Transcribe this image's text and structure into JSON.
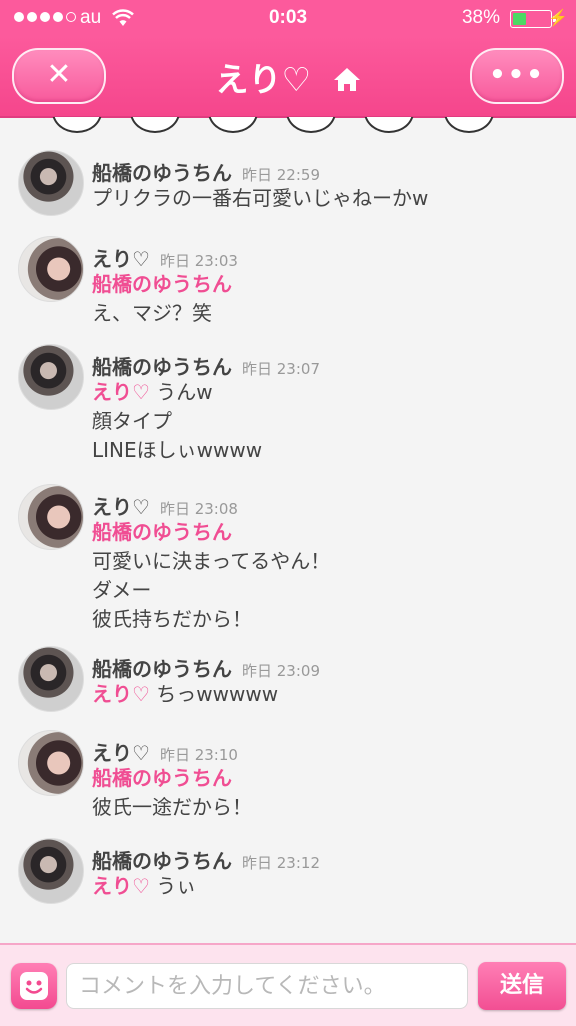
{
  "status_bar": {
    "carrier": "au",
    "time": "0:03",
    "battery_percent": "38%",
    "battery_level": 0.38,
    "signal_bars_filled": 4,
    "signal_bars_total": 5
  },
  "header": {
    "title": "えり♡",
    "close_icon_glyph": "✕",
    "more_icon_glyph": "•••",
    "accent_color": "#fc5a9c"
  },
  "messages": [
    {
      "author": "船橋のゆうちん",
      "avatar": "boy",
      "time": "昨日 22:59",
      "mention": "",
      "text": "プリクラの一番右可愛いじゃねーかw"
    },
    {
      "author": "えり♡",
      "avatar": "girl",
      "time": "昨日 23:03",
      "mention": "船橋のゆうちん",
      "text": "え、マジ？笑"
    },
    {
      "author": "船橋のゆうちん",
      "avatar": "boy",
      "time": "昨日 23:07",
      "mention": "えり♡",
      "text": " うんw\n顔タイプ\nLINEほしぃwwww"
    },
    {
      "author": "えり♡",
      "avatar": "girl",
      "time": "昨日 23:08",
      "mention": "船橋のゆうちん",
      "text": "可愛いに決まってるやん！\nダメー\n彼氏持ちだから！"
    },
    {
      "author": "船橋のゆうちん",
      "avatar": "boy",
      "time": "昨日 23:09",
      "mention": "えり♡",
      "text": " ちっwwwww"
    },
    {
      "author": "えり♡",
      "avatar": "girl",
      "time": "昨日 23:10",
      "mention": "船橋のゆうちん",
      "text": "彼氏一途だから！"
    },
    {
      "author": "船橋のゆうちん",
      "avatar": "boy",
      "time": "昨日 23:12",
      "mention": "えり♡",
      "text": " うぃ"
    }
  ],
  "footer": {
    "comment_placeholder": "コメントを入力してください。",
    "comment_value": "",
    "send_label": "送信"
  }
}
